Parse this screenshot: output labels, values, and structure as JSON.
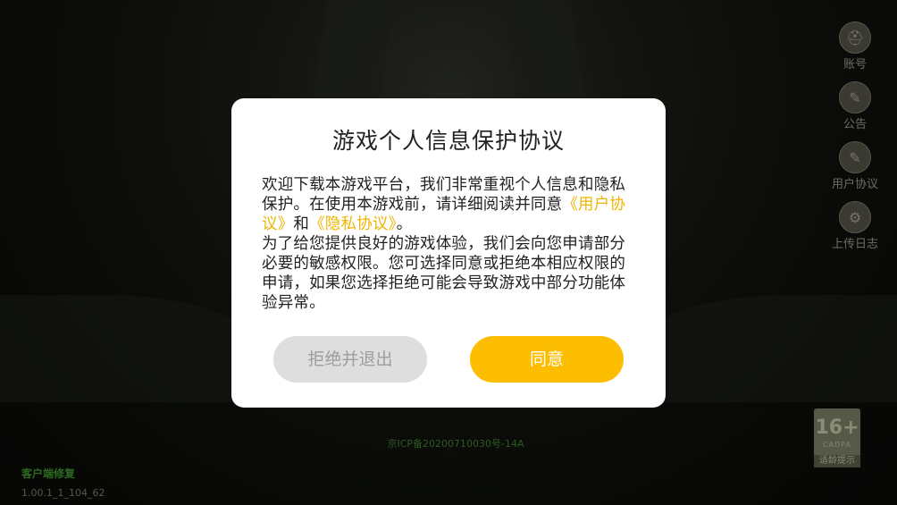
{
  "side_menu": [
    {
      "label": "账号",
      "icon": "helmet-icon",
      "glyph": "⛑"
    },
    {
      "label": "公告",
      "icon": "notice-icon",
      "glyph": "✎"
    },
    {
      "label": "用户协议",
      "icon": "agreement-icon",
      "glyph": "✎"
    },
    {
      "label": "上传日志",
      "icon": "upload-log-icon",
      "glyph": "⚙"
    }
  ],
  "age_rating": {
    "number": "16+",
    "sub": "CADPA",
    "label": "适龄提示"
  },
  "bottom": {
    "customer_service": "客户端修复",
    "version": "1.00.1_1_104_62",
    "footer_line1": "京ICP备20200710030号-14A"
  },
  "dialog": {
    "title": "游戏个人信息保护协议",
    "p1_text_a": "欢迎下载本游戏平台，我们非常重视个人信息和隐私保护。在使用本游戏前，请详细阅读并同意",
    "user_agreement_link": "《用户协议》",
    "p1_and": "和",
    "privacy_link": "《隐私协议》",
    "p1_end": "。",
    "p2": "为了给您提供良好的游戏体验，我们会向您申请部分必要的敏感权限。您可选择同意或拒绝本相应权限的申请，如果您选择拒绝可能会导致游戏中部分功能体验异常。",
    "reject_label": "拒绝并退出",
    "agree_label": "同意"
  },
  "colors": {
    "accent": "#fdbd00",
    "link": "#f0b400",
    "reject_bg": "#dedede",
    "reject_text": "#9d9d9d"
  }
}
